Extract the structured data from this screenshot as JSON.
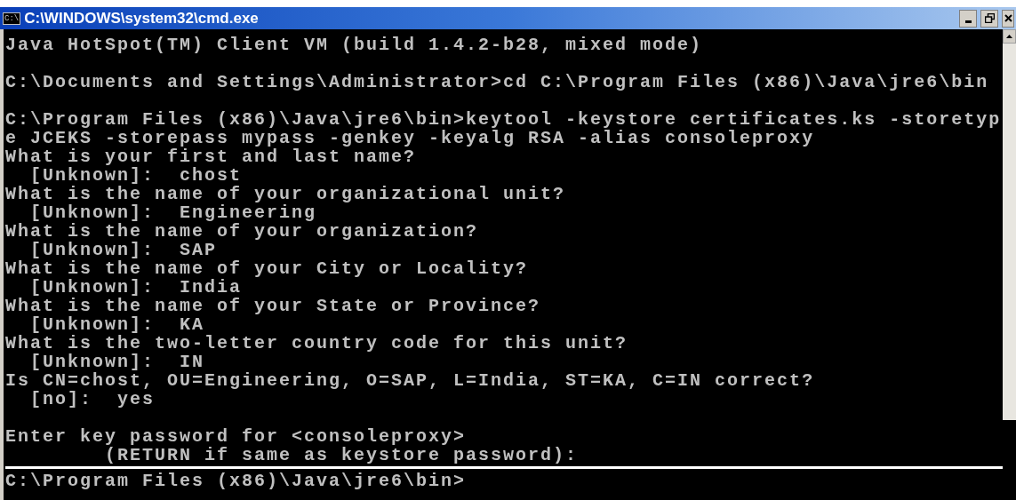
{
  "window": {
    "title": "C:\\WINDOWS\\system32\\cmd.exe",
    "icon_text": "C:\\"
  },
  "console_lines": [
    {
      "kind": "text",
      "text": "Java HotSpot(TM) Client VM (build 1.4.2-b28, mixed mode)"
    },
    {
      "kind": "blank"
    },
    {
      "kind": "text",
      "text": "C:\\Documents and Settings\\Administrator>cd C:\\Program Files (x86)\\Java\\jre6\\bin"
    },
    {
      "kind": "blank"
    },
    {
      "kind": "text",
      "text": "C:\\Program Files (x86)\\Java\\jre6\\bin>keytool -keystore certificates.ks -storetyp"
    },
    {
      "kind": "text",
      "text": "e JCEKS -storepass mypass -genkey -keyalg RSA -alias consoleproxy"
    },
    {
      "kind": "text",
      "text": "What is your first and last name?"
    },
    {
      "kind": "text",
      "text": "  [Unknown]:  chost"
    },
    {
      "kind": "text",
      "text": "What is the name of your organizational unit?"
    },
    {
      "kind": "text",
      "text": "  [Unknown]:  Engineering"
    },
    {
      "kind": "text",
      "text": "What is the name of your organization?"
    },
    {
      "kind": "text",
      "text": "  [Unknown]:  SAP"
    },
    {
      "kind": "text",
      "text": "What is the name of your City or Locality?"
    },
    {
      "kind": "text",
      "text": "  [Unknown]:  India"
    },
    {
      "kind": "text",
      "text": "What is the name of your State or Province?"
    },
    {
      "kind": "text",
      "text": "  [Unknown]:  KA"
    },
    {
      "kind": "text",
      "text": "What is the two-letter country code for this unit?"
    },
    {
      "kind": "text",
      "text": "  [Unknown]:  IN"
    },
    {
      "kind": "text",
      "text": "Is CN=chost, OU=Engineering, O=SAP, L=India, ST=KA, C=IN correct?"
    },
    {
      "kind": "text",
      "text": "  [no]:  yes"
    },
    {
      "kind": "blank"
    },
    {
      "kind": "text",
      "text": "Enter key password for <consoleproxy>"
    },
    {
      "kind": "text",
      "text": "        (RETURN if same as keystore password):"
    }
  ],
  "bottom_prompt": "C:\\Program Files (x86)\\Java\\jre6\\bin>"
}
